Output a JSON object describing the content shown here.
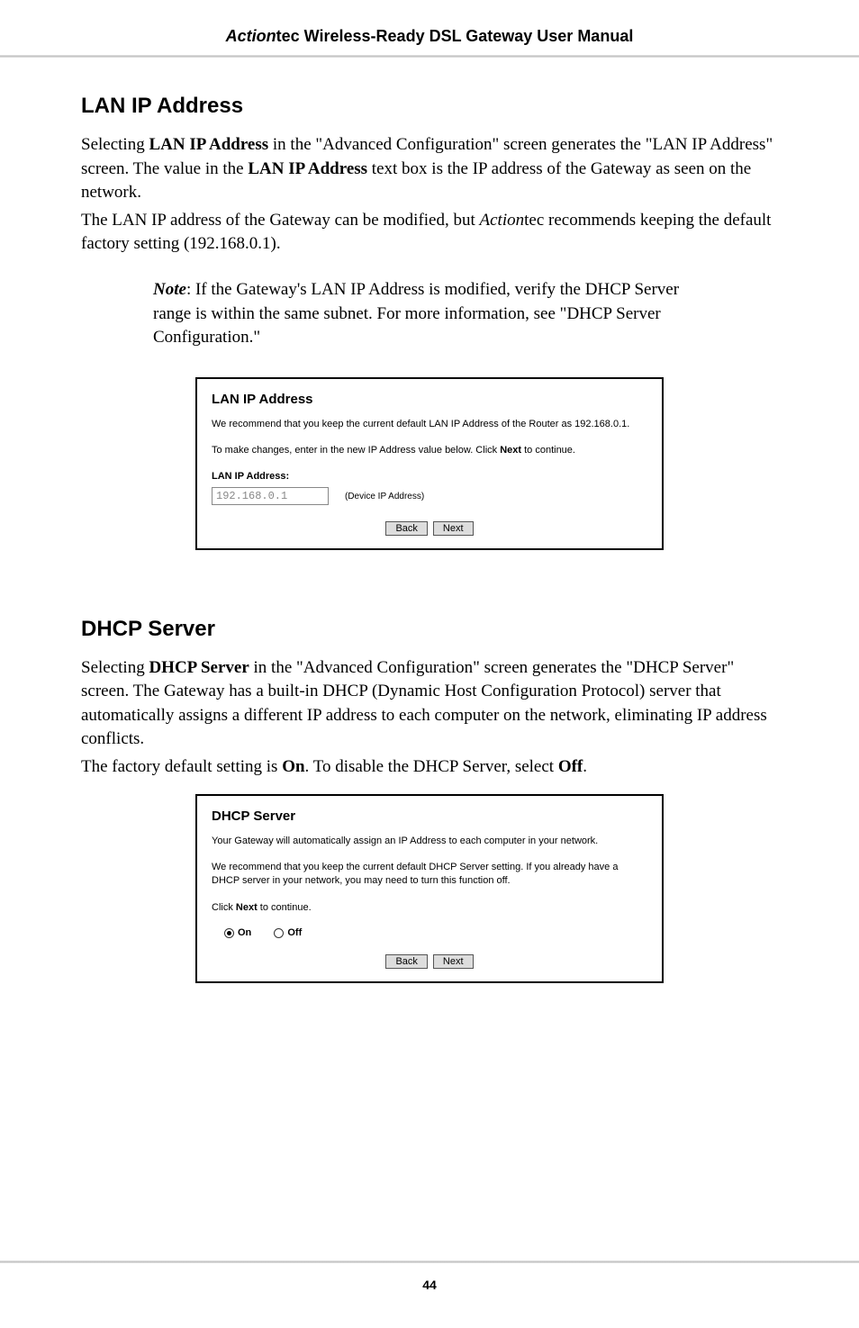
{
  "header": {
    "brand_italic": "Action",
    "brand_rest": "tec",
    "title_rest": " Wireless-Ready DSL Gateway User Manual"
  },
  "section1": {
    "heading": "LAN IP Address",
    "p1_a": "Selecting ",
    "p1_b": "LAN IP Address",
    "p1_c": " in the \"Advanced Configuration\" screen generates the \"",
    "p1_d": "LAN IP",
    "p1_e": " Address\" screen. The value in the ",
    "p1_f": "LAN IP Address",
    "p1_g": " text box is the ",
    "p1_h": "IP",
    "p1_i": " address of the Gateway as seen on the network.",
    "p2_a": "The ",
    "p2_b": "LAN IP",
    "p2_c": " address of the Gateway can be modified, but ",
    "p2_d": "Action",
    "p2_e": "tec recommends keeping the default factory setting (192.168.0.1).",
    "note_a": "Note",
    "note_b": ": If the Gateway's ",
    "note_c": "LAN IP",
    "note_d": " Address is modified, verify the ",
    "note_e": "DHCP",
    "note_f": " Server range is within the same subnet. For more information, see \"",
    "note_g": "DHCP",
    "note_h": " Server Configuration.\""
  },
  "screenshot1": {
    "title": "LAN IP Address",
    "p1": "We recommend that you keep the current default LAN IP Address of the Router as 192.168.0.1.",
    "p2_a": "To make changes, enter in the new IP Address value below. Click ",
    "p2_b": "Next",
    "p2_c": " to continue.",
    "label": "LAN IP Address:",
    "input_value": "192.168.0.1",
    "input_note": "(Device IP Address)",
    "back": "Back",
    "next": "Next"
  },
  "section2": {
    "heading": "DHCP Server",
    "p1_a": "Selecting ",
    "p1_b": "DHCP Server",
    "p1_c": " in the \"Advanced Configuration\" screen generates the \"",
    "p1_d": "DHCP",
    "p1_e": " Server\" screen. The Gateway has a built-in ",
    "p1_f": "DHCP",
    "p1_g": " (Dynamic Host Configuration Protocol) server that automatically assigns a different ",
    "p1_h": "IP",
    "p1_i": " address to each computer on the network, eliminating ",
    "p1_j": "IP",
    "p1_k": " address conflicts.",
    "p2_a": "The factory default setting is ",
    "p2_b": "On",
    "p2_c": ". To disable the ",
    "p2_d": "DHCP",
    "p2_e": " Server, select ",
    "p2_f": "Off",
    "p2_g": "."
  },
  "screenshot2": {
    "title": "DHCP Server",
    "p1": "Your Gateway will automatically assign an IP Address to each computer in your network.",
    "p2": "We recommend that you keep the current default DHCP Server setting. If you already have a DHCP server in your network, you may need to turn this function off.",
    "p3_a": "Click ",
    "p3_b": "Next",
    "p3_c": " to continue.",
    "radio_on": "On",
    "radio_off": "Off",
    "back": "Back",
    "next": "Next"
  },
  "footer": {
    "page": "44"
  }
}
